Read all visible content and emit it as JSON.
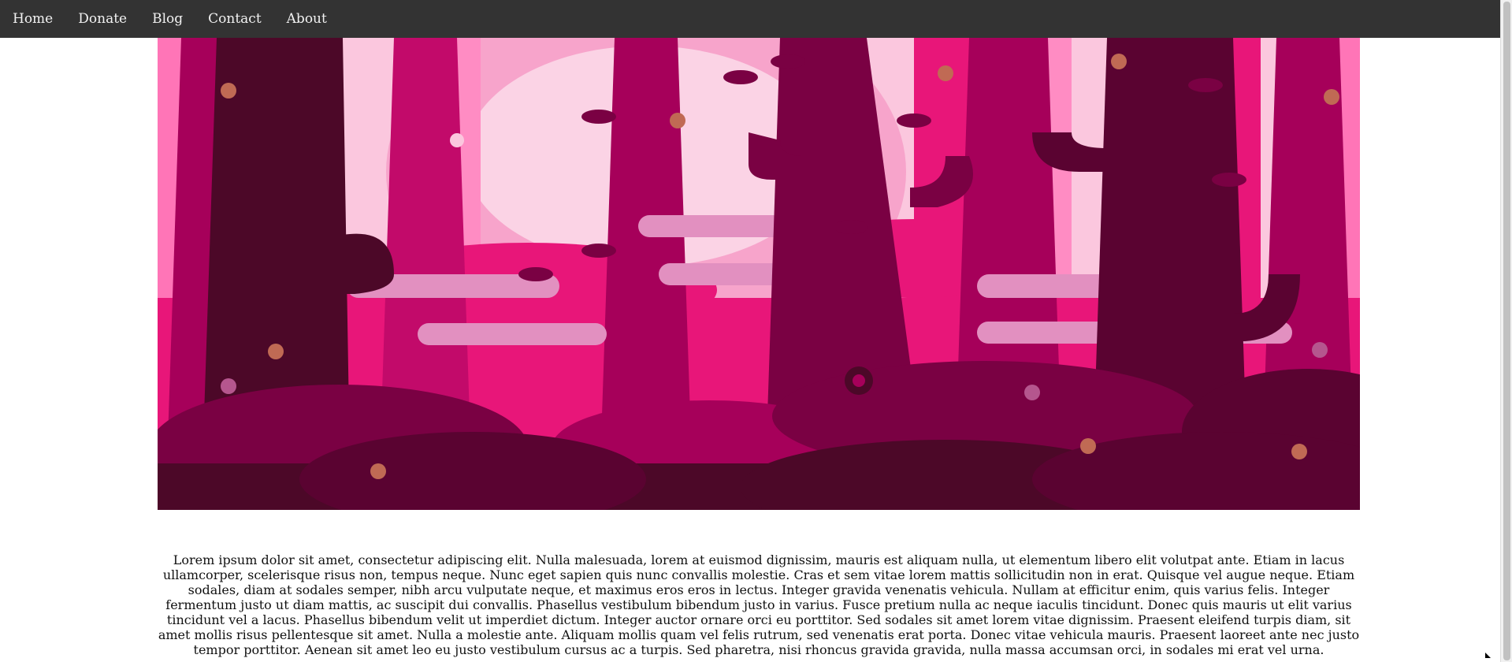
{
  "nav": {
    "items": [
      {
        "label": "Home"
      },
      {
        "label": "Donate"
      },
      {
        "label": "Blog"
      },
      {
        "label": "Contact"
      },
      {
        "label": "About"
      }
    ]
  },
  "hero": {
    "image": "forest-illustration",
    "palette": {
      "sky": "#fbc7de",
      "light_pink": "#ff75b7",
      "magenta": "#e81679",
      "mid": "#a6005a",
      "dark": "#7a0143",
      "darkest": "#4c0828",
      "cloud": "#e290c0",
      "spot": "#c06a54"
    }
  },
  "content": {
    "paragraph": "Lorem ipsum dolor sit amet, consectetur adipiscing elit. Nulla malesuada, lorem at euismod dignissim, mauris est aliquam nulla, ut elementum libero elit volutpat ante. Etiam in lacus ullamcorper, scelerisque risus non, tempus neque. Nunc eget sapien quis nunc convallis molestie. Cras et sem vitae lorem mattis sollicitudin non in erat. Quisque vel augue neque. Etiam sodales, diam at sodales semper, nibh arcu vulputate neque, et maximus eros eros in lectus. Integer gravida venenatis vehicula. Nullam at efficitur enim, quis varius felis. Integer fermentum justo ut diam mattis, ac suscipit dui convallis. Phasellus vestibulum bibendum justo in varius. Fusce pretium nulla ac neque iaculis tincidunt. Donec quis mauris ut elit varius tincidunt vel a lacus. Phasellus bibendum velit ut imperdiet dictum. Integer auctor ornare orci eu porttitor. Sed sodales sit amet lorem vitae dignissim. Praesent eleifend turpis diam, sit amet mollis risus pellentesque sit amet. Nulla a molestie ante. Aliquam mollis quam vel felis rutrum, sed venenatis erat porta. Donec vitae vehicula mauris. Praesent laoreet ante nec justo tempor porttitor. Aenean sit amet leo eu justo vestibulum cursus ac a turpis. Sed pharetra, nisi rhoncus gravida gravida, nulla massa accumsan orci, in sodales mi erat vel urna."
  }
}
